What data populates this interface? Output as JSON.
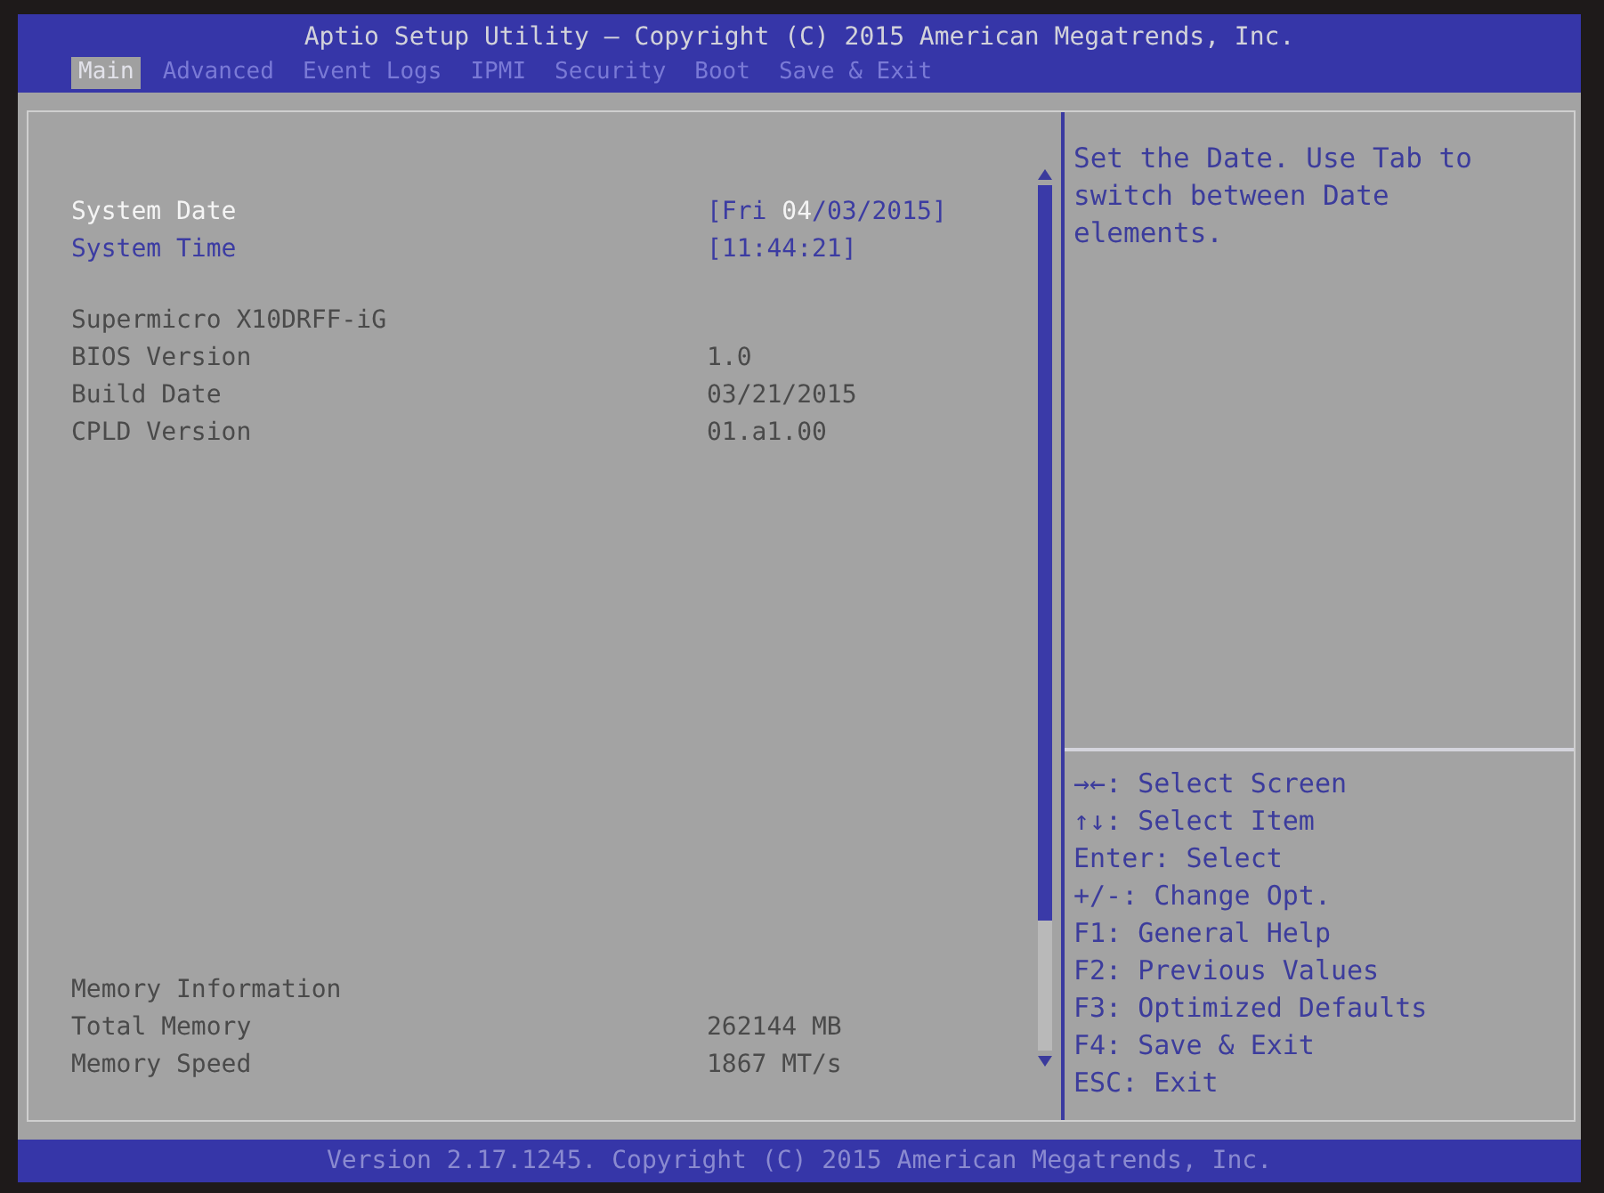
{
  "window": {
    "title": "Aptio Setup Utility – Copyright (C) 2015 American Megatrends, Inc."
  },
  "tabs": [
    {
      "label": "Main",
      "selected": true
    },
    {
      "label": "Advanced",
      "selected": false
    },
    {
      "label": "Event Logs",
      "selected": false
    },
    {
      "label": "IPMI",
      "selected": false
    },
    {
      "label": "Security",
      "selected": false
    },
    {
      "label": "Boot",
      "selected": false
    },
    {
      "label": "Save & Exit",
      "selected": false
    }
  ],
  "settings": {
    "sections": [
      {
        "rows": [
          {
            "kind": "setting",
            "label": "System Date",
            "selected": true,
            "value_parts": [
              {
                "text": "[Fri ",
                "selected": false
              },
              {
                "text": "04",
                "selected": true
              },
              {
                "text": "/03/2015]",
                "selected": false
              }
            ]
          },
          {
            "kind": "setting",
            "label": "System Time",
            "selected": false,
            "value_parts": [
              {
                "text": "[11:44:21]",
                "selected": false
              }
            ]
          }
        ]
      },
      {
        "rows": [
          {
            "kind": "heading",
            "label": "Supermicro X10DRFF-iG"
          },
          {
            "kind": "info",
            "label": "BIOS Version",
            "value": "1.0"
          },
          {
            "kind": "info",
            "label": "Build Date",
            "value": "03/21/2015"
          },
          {
            "kind": "info",
            "label": "CPLD Version",
            "value": "01.a1.00"
          }
        ]
      },
      {
        "rows": [
          {
            "kind": "heading",
            "label": "Memory Information"
          },
          {
            "kind": "info",
            "label": "Total Memory",
            "value": "262144 MB"
          },
          {
            "kind": "info",
            "label": "Memory Speed",
            "value": "1867 MT/s"
          }
        ]
      }
    ]
  },
  "help": {
    "text": "Set the Date. Use Tab to switch between Date elements."
  },
  "keys": [
    "→←: Select Screen",
    "↑↓: Select Item",
    "Enter: Select",
    "+/-: Change Opt.",
    "F1: General Help",
    "F2: Previous Values",
    "F3: Optimized Defaults",
    "F4: Save & Exit",
    "ESC: Exit"
  ],
  "footer": {
    "text": "Version 2.17.1245. Copyright (C) 2015 American Megatrends, Inc."
  }
}
